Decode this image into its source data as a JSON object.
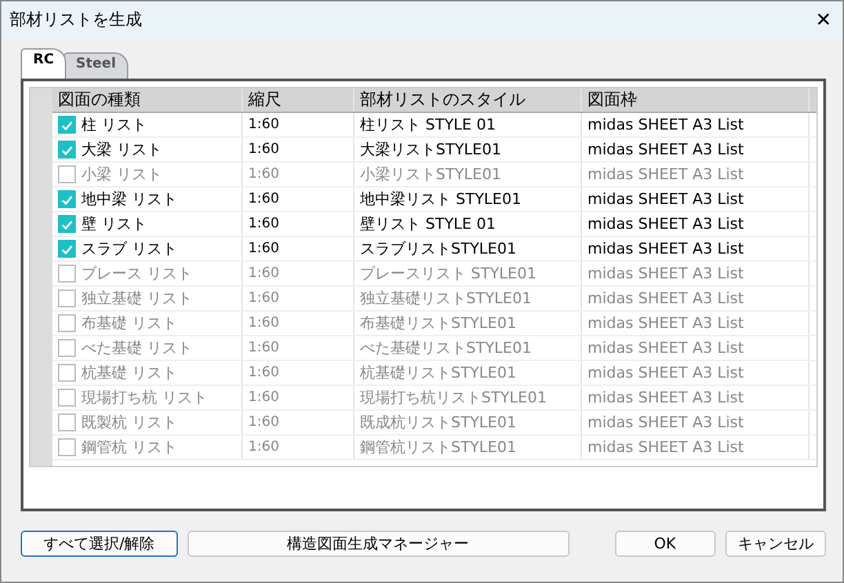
{
  "window": {
    "title": "部材リストを生成",
    "close": "✕"
  },
  "tabs": [
    {
      "label": "RC",
      "selected": true
    },
    {
      "label": "Steel",
      "selected": false
    }
  ],
  "table": {
    "columns": [
      "図面の種類",
      "縮尺",
      "部材リストのスタイル",
      "図面枠"
    ],
    "rows": [
      {
        "checked": true,
        "type": "柱 リスト",
        "scale": "1:60",
        "style": "柱リスト STYLE 01",
        "frame": "midas SHEET A3 List"
      },
      {
        "checked": true,
        "type": "大梁 リスト",
        "scale": "1:60",
        "style": "大梁リストSTYLE01",
        "frame": "midas SHEET A3 List"
      },
      {
        "checked": false,
        "type": "小梁 リスト",
        "scale": "1:60",
        "style": "小梁リストSTYLE01",
        "frame": "midas SHEET A3 List"
      },
      {
        "checked": true,
        "type": "地中梁 リスト",
        "scale": "1:60",
        "style": "地中梁リスト STYLE01",
        "frame": "midas SHEET A3 List"
      },
      {
        "checked": true,
        "type": "壁 リスト",
        "scale": "1:60",
        "style": "壁リスト STYLE 01",
        "frame": "midas SHEET A3 List"
      },
      {
        "checked": true,
        "type": "スラブ リスト",
        "scale": "1:60",
        "style": "スラブリストSTYLE01",
        "frame": "midas SHEET A3 List"
      },
      {
        "checked": false,
        "type": "ブレース リスト",
        "scale": "1:60",
        "style": "ブレースリスト STYLE01",
        "frame": "midas SHEET A3 List"
      },
      {
        "checked": false,
        "type": "独立基礎 リスト",
        "scale": "1:60",
        "style": "独立基礎リストSTYLE01",
        "frame": "midas SHEET A3 List"
      },
      {
        "checked": false,
        "type": "布基礎 リスト",
        "scale": "1:60",
        "style": "布基礎リストSTYLE01",
        "frame": "midas SHEET A3 List"
      },
      {
        "checked": false,
        "type": "べた基礎 リスト",
        "scale": "1:60",
        "style": "べた基礎リストSTYLE01",
        "frame": "midas SHEET A3 List"
      },
      {
        "checked": false,
        "type": "杭基礎 リスト",
        "scale": "1:60",
        "style": "杭基礎リストSTYLE01",
        "frame": "midas SHEET A3 List"
      },
      {
        "checked": false,
        "type": "現場打ち杭 リスト",
        "scale": "1:60",
        "style": "現場打ち杭リストSTYLE01",
        "frame": "midas SHEET A3 List"
      },
      {
        "checked": false,
        "type": "既製杭 リスト",
        "scale": "1:60",
        "style": "既成杭リストSTYLE01",
        "frame": "midas SHEET A3 List"
      },
      {
        "checked": false,
        "type": "鋼管杭 リスト",
        "scale": "1:60",
        "style": "鋼管杭リストSTYLE01",
        "frame": "midas SHEET A3 List"
      }
    ]
  },
  "buttons": [
    {
      "label": "すべて選択/解除",
      "kind": "focused"
    },
    {
      "label": "構造図面生成マネージャー",
      "kind": "wide"
    },
    {
      "label": "OK",
      "kind": "normal"
    },
    {
      "label": "キャンセル",
      "kind": "normal"
    }
  ]
}
